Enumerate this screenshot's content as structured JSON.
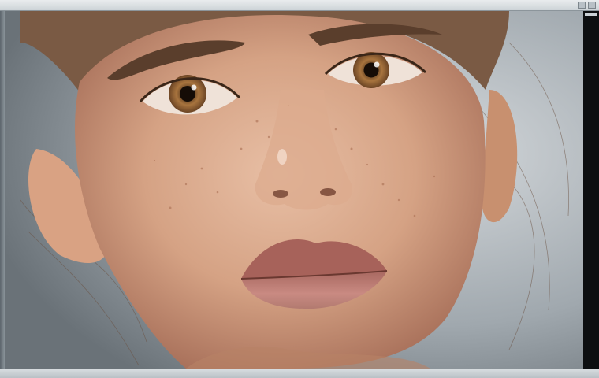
{
  "menubar": {
    "items": [
      "",
      "",
      "",
      ""
    ]
  },
  "status": {
    "text": ""
  },
  "canvas": {
    "subject-icon": "portrait-face",
    "skin_color": "#d9a88c",
    "eye_color": "#9a6a3c",
    "lip_color": "#b97a74",
    "background_color": "#aab1b6"
  }
}
